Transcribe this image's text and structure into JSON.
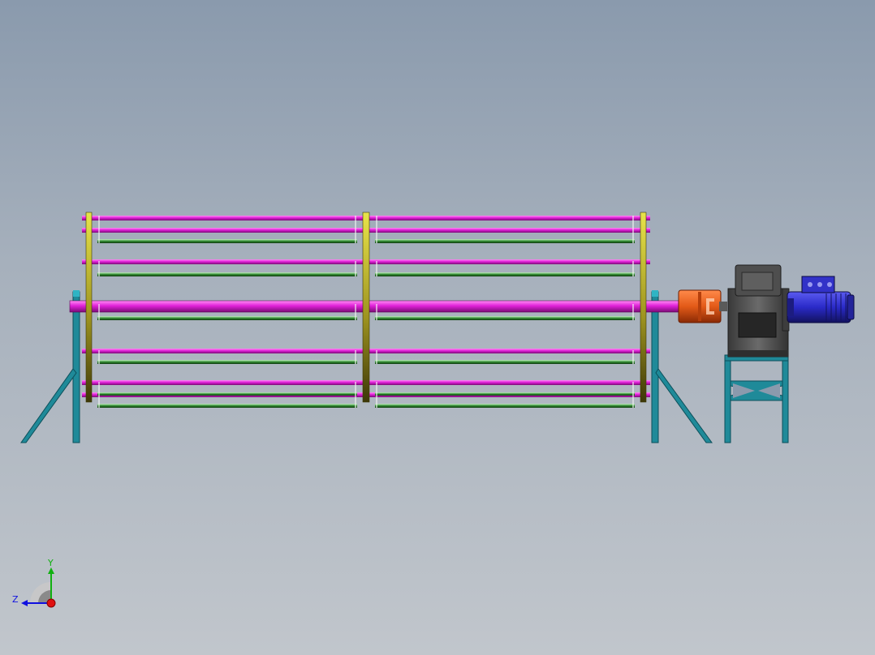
{
  "scene": {
    "description_label": "",
    "colors": {
      "background_top": "#8a9aad",
      "background_bottom": "#c1c6cc",
      "rod": "#e020d8",
      "rod_highlight": "#ff8cf5",
      "rail": "#2f8a2f",
      "rail_light": "#88e088",
      "ring": "#cfcb36",
      "ring_dark": "#5f5a12",
      "frame": "#1f8a99",
      "frame_dark": "#0c4f5a",
      "coupling": "#e35a18",
      "gearbox": "#4b4b4b",
      "gearbox_light": "#7c7c7c",
      "motor": "#2a2ac8",
      "motor_dark": "#161670"
    }
  },
  "triad": {
    "y_label": "Y",
    "z_label": "Z",
    "x_color": "#e01010",
    "y_color": "#10b010",
    "z_color": "#1010e0"
  }
}
